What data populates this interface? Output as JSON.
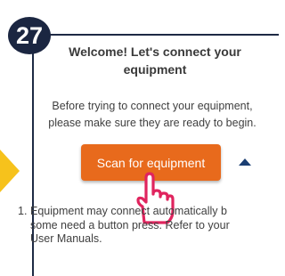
{
  "step": {
    "number": "27"
  },
  "card": {
    "title_line1": "Welcome! Let's connect your",
    "title_line2": "equipment",
    "desc_line1": "Before trying to connect your equipment,",
    "desc_line2": "please make sure they are ready to begin.",
    "scan_button": "Scan for equipment"
  },
  "notes": [
    {
      "number": "1.",
      "line1": "Equipment may connect automatically b",
      "line2": "some need a button press. Refer to your",
      "line3": "User Manuals."
    }
  ],
  "colors": {
    "accent": "#e86a1c",
    "badge": "#1b2641",
    "arrow_hint": "#f6c21c"
  },
  "icons": [
    "triangle-up-icon",
    "pointer-hand-icon"
  ]
}
